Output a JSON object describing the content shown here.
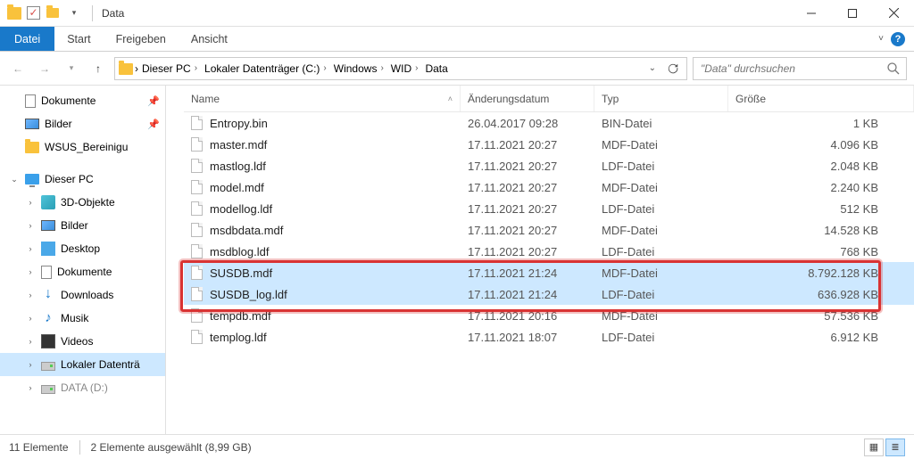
{
  "titlebar": {
    "title": "Data"
  },
  "ribbon": {
    "file": "Datei",
    "tabs": [
      "Start",
      "Freigeben",
      "Ansicht"
    ]
  },
  "breadcrumbs": [
    "Dieser PC",
    "Lokaler Datenträger (C:)",
    "Windows",
    "WID",
    "Data"
  ],
  "search": {
    "placeholder": "\"Data\" durchsuchen"
  },
  "navpane": {
    "quick": [
      {
        "label": "Dokumente",
        "icon": "doc",
        "pinned": true
      },
      {
        "label": "Bilder",
        "icon": "pic",
        "pinned": true
      },
      {
        "label": "WSUS_Bereinigu",
        "icon": "folder",
        "pinned": false
      }
    ],
    "thispc_label": "Dieser PC",
    "thispc": [
      {
        "label": "3D-Objekte",
        "icon": "cube"
      },
      {
        "label": "Bilder",
        "icon": "pic"
      },
      {
        "label": "Desktop",
        "icon": "desk"
      },
      {
        "label": "Dokumente",
        "icon": "doc"
      },
      {
        "label": "Downloads",
        "icon": "down"
      },
      {
        "label": "Musik",
        "icon": "music"
      },
      {
        "label": "Videos",
        "icon": "film"
      },
      {
        "label": "Lokaler Datenträ",
        "icon": "drive",
        "selected": true
      },
      {
        "label": "DATA (D:)",
        "icon": "drive",
        "faded": true
      }
    ]
  },
  "columns": {
    "name": "Name",
    "date": "Änderungsdatum",
    "type": "Typ",
    "size": "Größe"
  },
  "files": [
    {
      "name": "Entropy.bin",
      "date": "26.04.2017 09:28",
      "type": "BIN-Datei",
      "size": "1 KB"
    },
    {
      "name": "master.mdf",
      "date": "17.11.2021 20:27",
      "type": "MDF-Datei",
      "size": "4.096 KB"
    },
    {
      "name": "mastlog.ldf",
      "date": "17.11.2021 20:27",
      "type": "LDF-Datei",
      "size": "2.048 KB"
    },
    {
      "name": "model.mdf",
      "date": "17.11.2021 20:27",
      "type": "MDF-Datei",
      "size": "2.240 KB"
    },
    {
      "name": "modellog.ldf",
      "date": "17.11.2021 20:27",
      "type": "LDF-Datei",
      "size": "512 KB"
    },
    {
      "name": "msdbdata.mdf",
      "date": "17.11.2021 20:27",
      "type": "MDF-Datei",
      "size": "14.528 KB"
    },
    {
      "name": "msdblog.ldf",
      "date": "17.11.2021 20:27",
      "type": "LDF-Datei",
      "size": "768 KB"
    },
    {
      "name": "SUSDB.mdf",
      "date": "17.11.2021 21:24",
      "type": "MDF-Datei",
      "size": "8.792.128 KB",
      "selected": true
    },
    {
      "name": "SUSDB_log.ldf",
      "date": "17.11.2021 21:24",
      "type": "LDF-Datei",
      "size": "636.928 KB",
      "selected": true
    },
    {
      "name": "tempdb.mdf",
      "date": "17.11.2021 20:16",
      "type": "MDF-Datei",
      "size": "57.536 KB"
    },
    {
      "name": "templog.ldf",
      "date": "17.11.2021 18:07",
      "type": "LDF-Datei",
      "size": "6.912 KB"
    }
  ],
  "status": {
    "count": "11 Elemente",
    "selection": "2 Elemente ausgewählt (8,99 GB)"
  }
}
